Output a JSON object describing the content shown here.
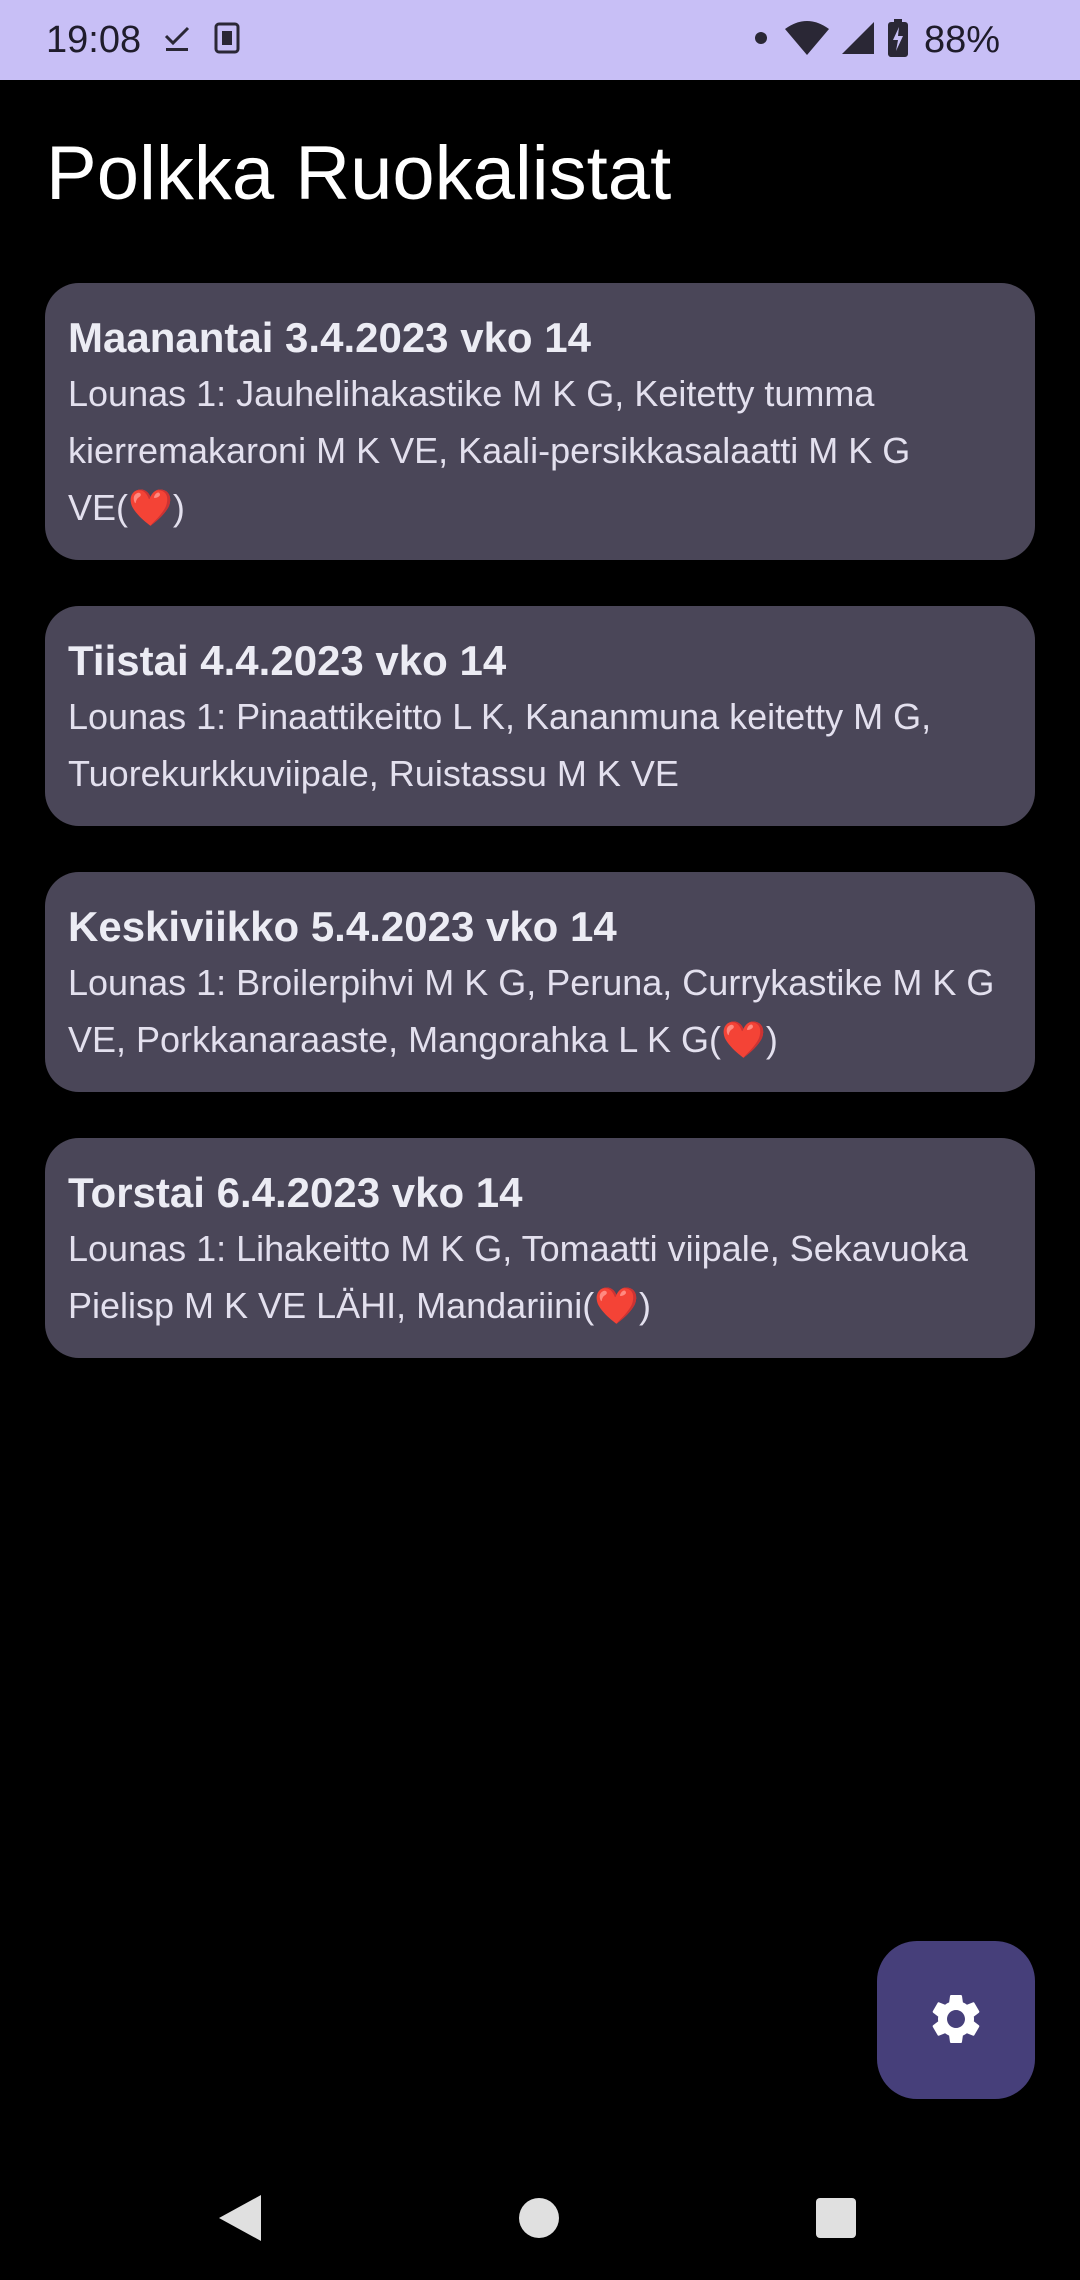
{
  "status_bar": {
    "time": "19:08",
    "battery_percent": "88%",
    "icons": [
      "download-done-icon",
      "sim-icon",
      "notification-dot-icon",
      "wifi-icon",
      "cell-signal-icon",
      "battery-charging-icon"
    ]
  },
  "app": {
    "title": "Polkka Ruokalistat"
  },
  "days": [
    {
      "title": "Maanantai 3.4.2023 vko 14",
      "menu": "Lounas 1: Jauhelihakastike M K G, Keitetty tumma kierremakaroni  M K VE, Kaali-persikkasalaatti M K G VE(❤️)"
    },
    {
      "title": "Tiistai 4.4.2023 vko 14",
      "menu": "Lounas 1: Pinaattikeitto L K, Kananmuna keitetty M G, Tuorekurkkuviipale, Ruistassu M K VE"
    },
    {
      "title": "Keskiviikko 5.4.2023 vko 14",
      "menu": "Lounas 1: Broilerpihvi M K G, Peruna, Currykastike M K G VE, Porkkanaraaste, Mangorahka L K G(❤️)"
    },
    {
      "title": "Torstai 6.4.2023 vko 14",
      "menu": "Lounas 1: Lihakeitto M K G, Tomaatti viipale, Sekavuoka Pielisp M K VE LÄHI, Mandariini(❤️)"
    }
  ],
  "fab": {
    "icon": "gear-icon"
  },
  "navigation": {
    "buttons": [
      "back-icon",
      "home-icon",
      "recents-icon"
    ]
  },
  "colors": {
    "status_bar_bg": "#c8bff6",
    "background": "#000000",
    "card_bg": "#4a4658",
    "fab_bg": "#463f7a",
    "nav_icon": "#e0e0e0"
  }
}
